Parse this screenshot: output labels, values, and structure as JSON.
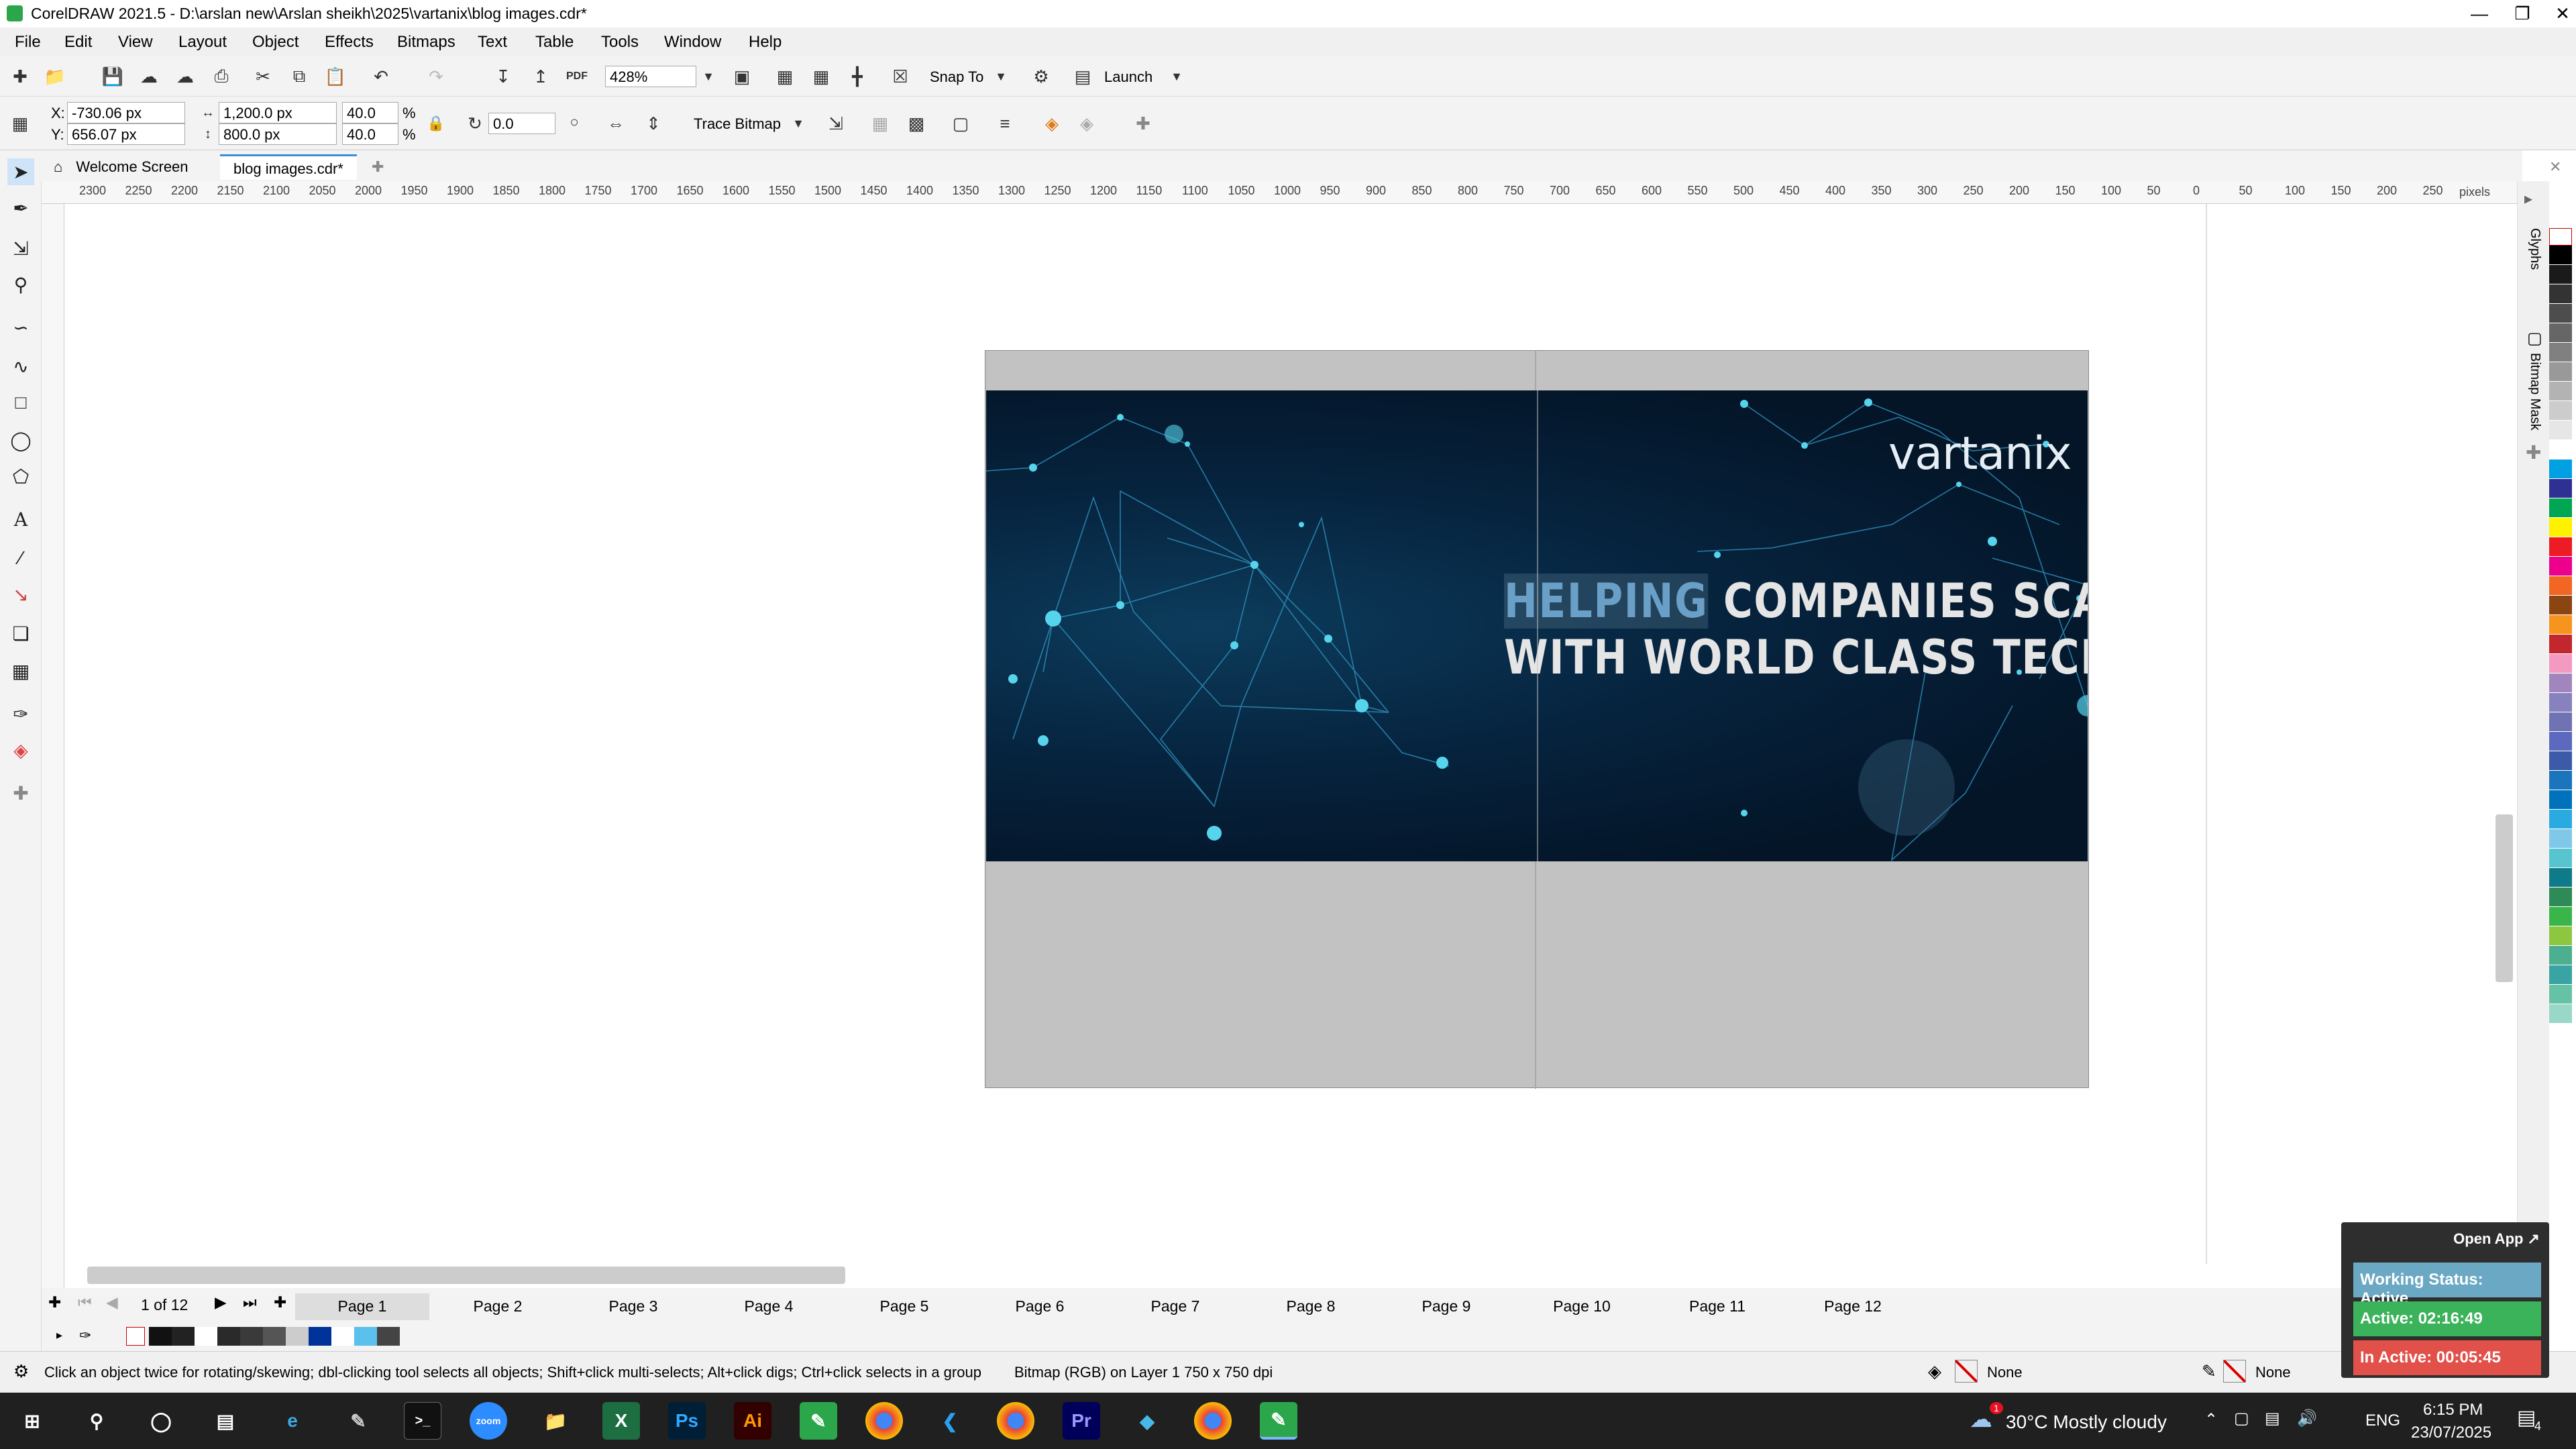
{
  "title_bar": {
    "title": "CorelDRAW 2021.5 - D:\\arslan new\\Arslan sheikh\\2025\\vartanix\\blog images.cdr*"
  },
  "menu": [
    "File",
    "Edit",
    "View",
    "Layout",
    "Object",
    "Effects",
    "Bitmaps",
    "Text",
    "Table",
    "Tools",
    "Window",
    "Help"
  ],
  "toolbar": {
    "zoom": "428%",
    "snap_to": "Snap To",
    "launch": "Launch",
    "pdf": "PDF"
  },
  "property_bar": {
    "x": "-730.06 px",
    "y": "656.07 px",
    "width": "1,200.0 px",
    "height": "800.0 px",
    "scale_w": "40.0",
    "scale_h": "40.0",
    "pct": "%",
    "rotation": "0.0",
    "trace_bitmap": "Trace Bitmap",
    "x_label": "X:",
    "y_label": "Y:"
  },
  "tabs": {
    "welcome": "Welcome Screen",
    "document": "blog images.cdr*"
  },
  "ruler": {
    "h_ticks": [
      "2300",
      "2250",
      "2200",
      "2150",
      "2100",
      "2050",
      "2000",
      "1950",
      "1900",
      "1850",
      "1800",
      "1750",
      "1700",
      "1650",
      "1600",
      "1550",
      "1500",
      "1450",
      "1400",
      "1350",
      "1300",
      "1250",
      "1200",
      "1150",
      "1100",
      "1050",
      "1000",
      "950",
      "900",
      "850",
      "800",
      "750",
      "700",
      "650",
      "600",
      "550",
      "500",
      "450",
      "400",
      "350",
      "300",
      "250",
      "200",
      "150",
      "100",
      "50",
      "0",
      "50",
      "100",
      "150",
      "200",
      "250"
    ],
    "unit": "pixels"
  },
  "artwork": {
    "brand": "vartanix",
    "headline_highlight": "HELPING",
    "headline_line1_rest": " COMPANIES SCALE",
    "headline_line2": "WITH WORLD CLASS TECH"
  },
  "pages": {
    "counter": "1 of 12",
    "tabs": [
      "Page 1",
      "Page 2",
      "Page 3",
      "Page 4",
      "Page 5",
      "Page 6",
      "Page 7",
      "Page 8",
      "Page 9",
      "Page 10",
      "Page 11",
      "Page 12"
    ]
  },
  "status": {
    "hint": "Click an object twice for rotating/skewing; dbl-clicking tool selects all objects; Shift+click multi-selects; Alt+click digs; Ctrl+click selects in a group",
    "object_info": "Bitmap (RGB) on Layer 1 750 x 750 dpi",
    "fill": "None",
    "outline": "None"
  },
  "docker": {
    "glyphs": "Glyphs",
    "bitmap_mask": "Bitmap Mask"
  },
  "widget": {
    "open_app": "Open App ↗",
    "working_status": "Working Status: Active",
    "active": "Active: 02:16:49",
    "inactive": "In Active: 00:05:45"
  },
  "taskbar": {
    "weather": "30°C  Mostly cloudy",
    "lang": "ENG",
    "time": "6:15 PM",
    "date": "23/07/2025",
    "notif_count": "4",
    "weather_badge": "1"
  },
  "colors": {
    "accent": "#3b8fd8",
    "palette": [
      "#000000",
      "#1a1a1a",
      "#333333",
      "#4d4d4d",
      "#666666",
      "#808080",
      "#999999",
      "#b3b3b3",
      "#cccccc",
      "#e6e6e6",
      "#ffffff",
      "#00a0e3",
      "#2e3192",
      "#00a651",
      "#fff200",
      "#ed1c24",
      "#ec008c",
      "#f26522",
      "#8b4513",
      "#f7941d",
      "#c1272d",
      "#f49ac1",
      "#a186be",
      "#8781bd",
      "#6f73b3",
      "#5b6abf",
      "#3d5aa8",
      "#1b75bc",
      "#0072bc",
      "#29abe2",
      "#7fc8e8",
      "#56c5d0",
      "#0f7b8a",
      "#2e8b57",
      "#39b54a",
      "#8dc63f",
      "#4caf90",
      "#3aa3a3",
      "#66c2a5",
      "#99d8c9"
    ],
    "doc_palette": [
      "#111111",
      "#222222",
      "#ffffff",
      "#2a2a2a",
      "#3a3a3a",
      "#555555",
      "#cccccc",
      "#003399",
      "#ffffff",
      "#5bc0eb",
      "#444444"
    ]
  }
}
